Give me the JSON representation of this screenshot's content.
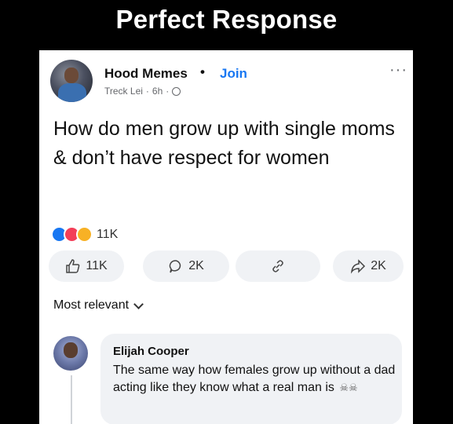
{
  "meme_title": "Perfect Response",
  "post": {
    "group_name": "Hood Memes",
    "separator": "•",
    "join_label": "Join",
    "author": "Treck Lei",
    "time": "6h",
    "meta_dot": "·",
    "text": "How do men grow up with single moms & don’t have respect for women",
    "reaction_count": "11K",
    "reaction_icons": [
      "like-reaction",
      "love-reaction",
      "haha-reaction"
    ]
  },
  "actions": {
    "like_count": "11K",
    "comment_count": "2K",
    "share_count": "2K"
  },
  "sort_label": "Most relevant",
  "comment": {
    "name": "Elijah Cooper",
    "text": "The same way how females grow up without a dad acting like they know what a real man is",
    "emoji": "☠☠"
  },
  "colors": {
    "accent": "#1877f2",
    "muted": "#65676b",
    "pill_bg": "#f0f2f5"
  }
}
